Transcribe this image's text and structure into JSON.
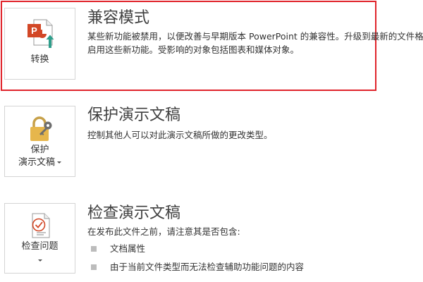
{
  "compatibility": {
    "title": "兼容模式",
    "description_line1": "某些新功能被禁用，以便改善与早期版本 PowerPoint 的兼容性。升级到最新的文件格式将",
    "description_line2": "启用这些新功能。受影响的对象包括图表和媒体对象。",
    "button_label": "转换",
    "icon": "powerpoint-convert-icon"
  },
  "protect": {
    "title": "保护演示文稿",
    "description": "控制其他人可以对此演示文稿所做的更改类型。",
    "button_label_line1": "保护",
    "button_label_line2": "演示文稿",
    "icon": "lock-key-icon"
  },
  "inspect": {
    "title": "检查演示文稿",
    "description": "在发布此文件之前，请注意其是否包含:",
    "button_label": "检查问题",
    "icon": "checklist-icon",
    "items": [
      "文档属性",
      "由于当前文件类型而无法检查辅助功能问题的内容"
    ]
  },
  "colors": {
    "highlight": "#e0242b",
    "powerpoint_orange": "#d24726",
    "arrow_teal": "#2e9e8b",
    "lock_gold": "#e6b64c"
  }
}
